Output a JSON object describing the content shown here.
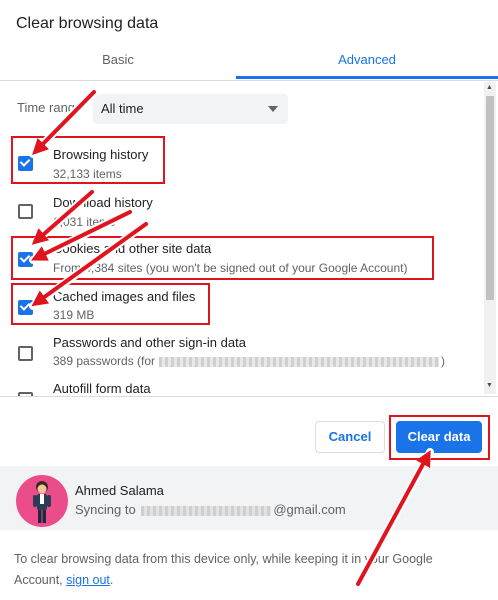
{
  "dialog": {
    "title": "Clear browsing data"
  },
  "tabs": [
    {
      "label": "Basic",
      "active": false
    },
    {
      "label": "Advanced",
      "active": true
    }
  ],
  "time_range": {
    "label": "Time range",
    "value": "All time"
  },
  "options": [
    {
      "title": "Browsing history",
      "subtitle": "32,133 items",
      "checked": true
    },
    {
      "title": "Download history",
      "subtitle": "1,031 items",
      "checked": false
    },
    {
      "title": "Cookies and other site data",
      "subtitle": "From 4,384 sites (you won't be signed out of your Google Account)",
      "checked": true
    },
    {
      "title": "Cached images and files",
      "subtitle": "319 MB",
      "checked": true
    },
    {
      "title": "Passwords and other sign-in data",
      "subtitle": "389 passwords (for",
      "subtitle_end": ")",
      "checked": false
    },
    {
      "title": "Autofill form data",
      "subtitle": "",
      "checked": false
    }
  ],
  "buttons": {
    "cancel": "Cancel",
    "clear": "Clear data"
  },
  "account": {
    "name": "Ahmed Salama",
    "sync_prefix": "Syncing to",
    "sync_suffix": "@gmail.com"
  },
  "footer_note": {
    "text": "To clear browsing data from this device only, while keeping it in your Google Account,",
    "link": "sign out",
    "end": "."
  },
  "colors": {
    "accent": "#1a73e8",
    "highlight": "#e0141e"
  }
}
